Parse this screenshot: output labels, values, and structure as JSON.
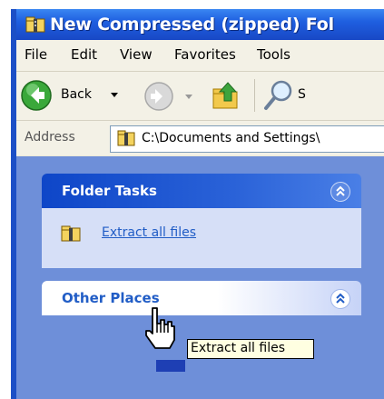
{
  "window": {
    "title": "New Compressed (zipped) Fol"
  },
  "menu": {
    "items": [
      "File",
      "Edit",
      "View",
      "Favorites",
      "Tools"
    ]
  },
  "toolbar": {
    "back_label": "Back",
    "search_partial": "S"
  },
  "address": {
    "label": "Address",
    "path": "C:\\Documents and Settings\\"
  },
  "folder_tasks": {
    "title": "Folder Tasks",
    "items": [
      {
        "label": "Extract all files",
        "icon": "zip-folder-icon"
      }
    ]
  },
  "other_places": {
    "title": "Other Places"
  },
  "tooltip": {
    "text": "Extract all files"
  },
  "colors": {
    "titlebar": "#1f5fe0",
    "task_pane": "#6e8fd9",
    "task_header": "#ffffff",
    "task_title_text": "#215dc6",
    "link": "#215dc6"
  }
}
